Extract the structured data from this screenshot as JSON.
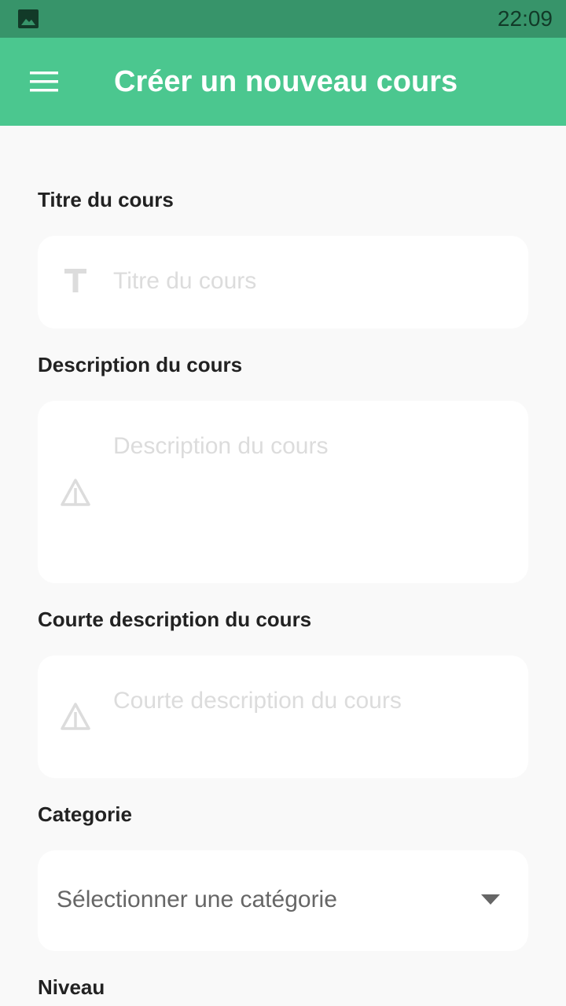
{
  "status_bar": {
    "time": "22:09",
    "notification_icon": "image-icon"
  },
  "app_bar": {
    "title": "Créer un nouveau cours",
    "menu_icon": "menu-icon"
  },
  "form": {
    "title_field": {
      "label": "Titre du cours",
      "placeholder": "Titre du cours",
      "value": "",
      "icon": "text-icon"
    },
    "description_field": {
      "label": "Description du cours",
      "placeholder": "Description du cours",
      "value": "",
      "icon": "warning-icon"
    },
    "short_description_field": {
      "label": "Courte description du cours",
      "placeholder": "Courte description du cours",
      "value": "",
      "icon": "warning-icon"
    },
    "category_field": {
      "label": "Categorie",
      "selected": "Sélectionner une catégorie",
      "icon": "dropdown-arrow-icon"
    },
    "level_field": {
      "label": "Niveau"
    }
  },
  "colors": {
    "status_bar": "#37946a",
    "app_bar": "#4bc78f",
    "background": "#f9f9f9",
    "field_background": "#ffffff",
    "placeholder": "#dcdcdc"
  }
}
